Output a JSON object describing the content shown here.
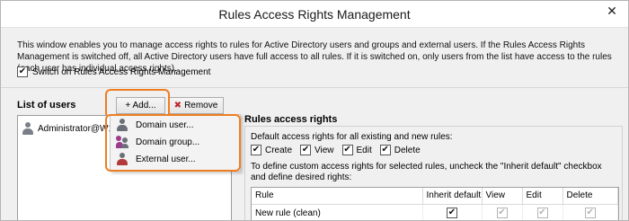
{
  "window": {
    "title": "Rules Access Rights Management",
    "close_glyph": "✕"
  },
  "description": "This window enables you to manage access rights to rules for Active Directory users and groups and external users. If the Rules Access Rights Management is switched off, all Active Directory users have full access to all rules. If it is switched on, only users from the list have access to the rules (each user has individual access rights).",
  "switch": {
    "label": "Switch on Rules Access Rights Management",
    "checked": true
  },
  "users": {
    "label": "List of users",
    "add_button": "+ Add...",
    "remove_button": "Remove",
    "remove_icon": "✖",
    "items": [
      {
        "name": "Administrator@W12E",
        "icon": "user-icon"
      }
    ]
  },
  "add_menu": {
    "items": [
      {
        "label": "Domain user...",
        "icon": "domain-user-icon"
      },
      {
        "label": "Domain group...",
        "icon": "domain-group-icon"
      },
      {
        "label": "External user...",
        "icon": "external-user-icon"
      }
    ]
  },
  "rights": {
    "title": "Rules access rights",
    "default_label": "Default access rights for all existing and new rules:",
    "permissions": [
      {
        "label": "Create",
        "checked": true
      },
      {
        "label": "View",
        "checked": true
      },
      {
        "label": "Edit",
        "checked": true
      },
      {
        "label": "Delete",
        "checked": true
      }
    ],
    "custom_text": "To define custom access rights for selected rules, uncheck the \"Inherit default\" checkbox and define desired rights:",
    "table": {
      "columns": [
        "Rule",
        "Inherit default",
        "View",
        "Edit",
        "Delete"
      ],
      "rows": [
        {
          "rule": "New rule (clean)",
          "inherit": true,
          "view": true,
          "edit": true,
          "delete": true
        }
      ]
    }
  },
  "colors": {
    "highlight": "#ee7d21",
    "user_icon": "#7a7f8a",
    "group_icon_primary": "#9b3c8c",
    "external_icon": "#b23a3a"
  }
}
